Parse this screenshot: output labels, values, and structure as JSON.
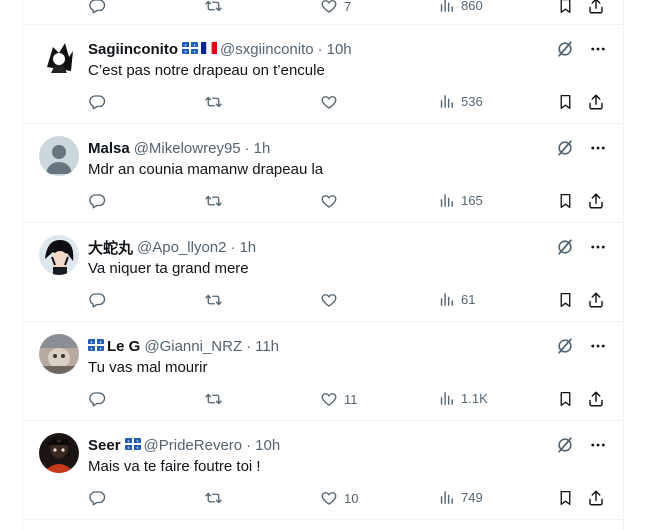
{
  "top_partial": {
    "likes": "7",
    "views": "860"
  },
  "replies": [
    {
      "name": "Sagiinconito",
      "flags": [
        "quebec",
        "france"
      ],
      "handle": "@sxgiinconito",
      "time": "10h",
      "text": "C’est pas notre drapeau on t’encule",
      "likes": "",
      "views": "536",
      "avatar": "sketch"
    },
    {
      "name": "Malsa",
      "flags": [],
      "handle": "@Mikelowrey95",
      "time": "1h",
      "text": "Mdr an counia mamanw drapeau la",
      "likes": "",
      "views": "165",
      "avatar": "default"
    },
    {
      "name": "大蛇丸",
      "flags": [],
      "handle": "@Apo_llyon2",
      "time": "1h",
      "text": "Va niquer ta grand mere",
      "likes": "",
      "views": "61",
      "avatar": "anime"
    },
    {
      "name": "Le G",
      "flags_before": [
        "quebec"
      ],
      "flags": [],
      "handle": "@Gianni_NRZ",
      "time": "11h",
      "text": "Tu vas mal mourir",
      "likes": "11",
      "views": "1.1K",
      "avatar": "photo"
    },
    {
      "name": "Seer",
      "flags": [
        "quebec"
      ],
      "handle": "@PrideRevero",
      "time": "10h",
      "text": "Mais va te faire foutre toi !",
      "likes": "10",
      "views": "749",
      "avatar": "dark"
    }
  ],
  "icons": {
    "reply": "reply-icon",
    "retweet": "retweet-icon",
    "like": "like-icon",
    "views": "views-icon",
    "bookmark": "bookmark-icon",
    "share": "share-icon",
    "grok": "grok-icon",
    "more": "more-icon"
  },
  "colors": {
    "text": "#0f1419",
    "muted": "#536471",
    "border": "#eff3f4",
    "quebec_blue": "#1f5bb5",
    "france_red": "#e1000f"
  }
}
